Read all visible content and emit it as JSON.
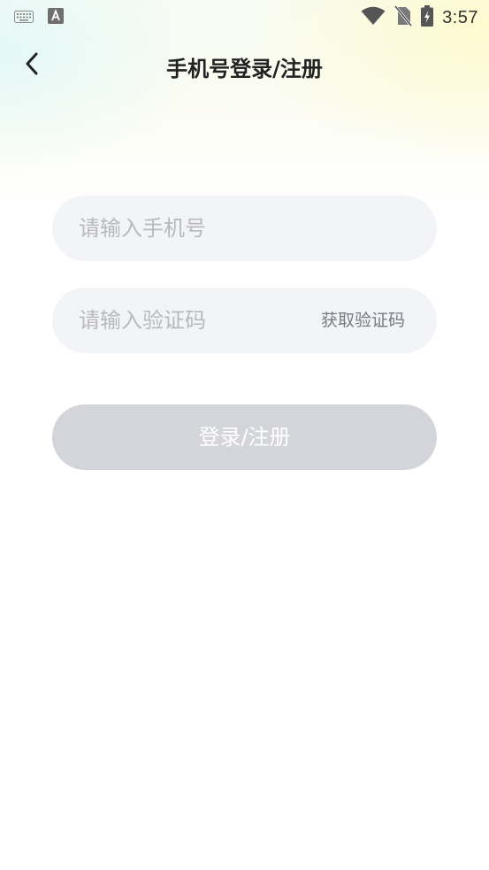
{
  "status_bar": {
    "time": "3:57",
    "left_icons": [
      "keyboard-icon",
      "text-a-icon"
    ],
    "right_icons": [
      "wifi-icon",
      "no-sim-icon",
      "battery-charging-icon"
    ]
  },
  "header": {
    "title": "手机号登录/注册",
    "back_icon": "chevron-left-icon"
  },
  "form": {
    "phone": {
      "value": "",
      "placeholder": "请输入手机号"
    },
    "code": {
      "value": "",
      "placeholder": "请输入验证码",
      "get_code_label": "获取验证码"
    },
    "submit_label": "登录/注册"
  },
  "colors": {
    "field_bg": "#f3f4f7",
    "button_disabled_bg": "#d3d5da",
    "title_text": "#222222",
    "placeholder_text": "#b8b9bf"
  }
}
